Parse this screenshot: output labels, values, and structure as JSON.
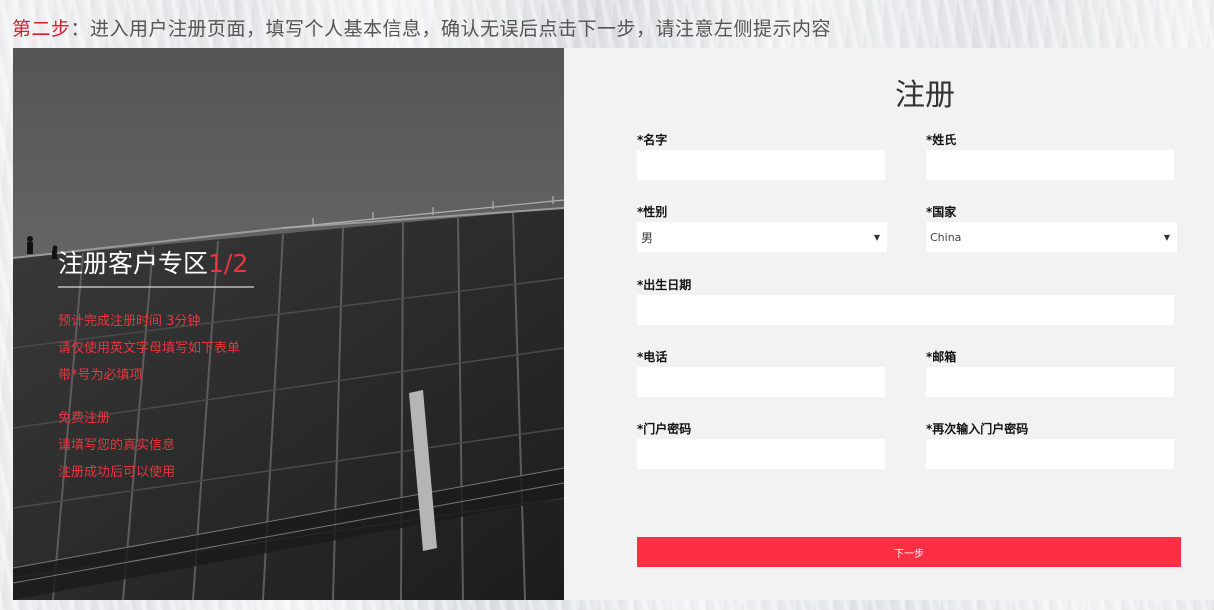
{
  "instruction": {
    "step_label": "第二步",
    "text": "：进入用户注册页面，填写个人基本信息，确认无误后点击下一步，请注意左侧提示内容"
  },
  "left_panel": {
    "title": "注册客户专区",
    "progress": "1/2",
    "notes": [
      "预计完成注册时间 3分钟",
      "请仅使用英文字母填写如下表单",
      "带*号为必填项"
    ],
    "notes_secondary": [
      "免费注册",
      "请填写您的真实信息",
      "注册成功后可以使用"
    ]
  },
  "form": {
    "title": "注册",
    "first_name": {
      "label": "*名字",
      "value": ""
    },
    "last_name": {
      "label": "*姓氏",
      "value": ""
    },
    "gender": {
      "label": "*性别",
      "value": "男"
    },
    "country": {
      "label": "*国家",
      "value": "China"
    },
    "birthdate": {
      "label": "*出生日期",
      "value": ""
    },
    "phone": {
      "label": "*电话",
      "value": ""
    },
    "email": {
      "label": "*邮箱",
      "value": ""
    },
    "password": {
      "label": "*门户密码",
      "value": ""
    },
    "password_confirm": {
      "label": "*再次输入门户密码",
      "value": ""
    },
    "next_button": "下一步"
  },
  "colors": {
    "accent_red": "#fd2f45",
    "note_red": "#e8353f",
    "step_red": "#d6222f",
    "form_bg": "#f2f2f2"
  },
  "icons": {
    "select_caret": "triangle-down"
  }
}
